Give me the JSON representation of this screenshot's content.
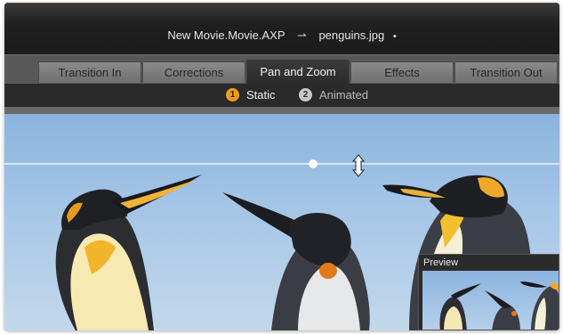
{
  "window": {
    "project": "New Movie.Movie.AXP",
    "separator": "⇀",
    "file": "penguins.jpg",
    "modified_marker": "•"
  },
  "tabs": [
    {
      "label": "Transition In",
      "active": false
    },
    {
      "label": "Corrections",
      "active": false
    },
    {
      "label": "Pan and Zoom",
      "active": true
    },
    {
      "label": "Effects",
      "active": false
    },
    {
      "label": "Transition Out",
      "active": false
    }
  ],
  "modes": [
    {
      "number": "1",
      "label": "Static",
      "selected": true
    },
    {
      "number": "2",
      "label": "Animated",
      "selected": false
    }
  ],
  "preview": {
    "label": "Preview"
  },
  "colors": {
    "accent": "#f29a1a",
    "active_tab": "#2f2f2f",
    "tab": "#7d7d7d",
    "sky": "#a6c6e6"
  }
}
